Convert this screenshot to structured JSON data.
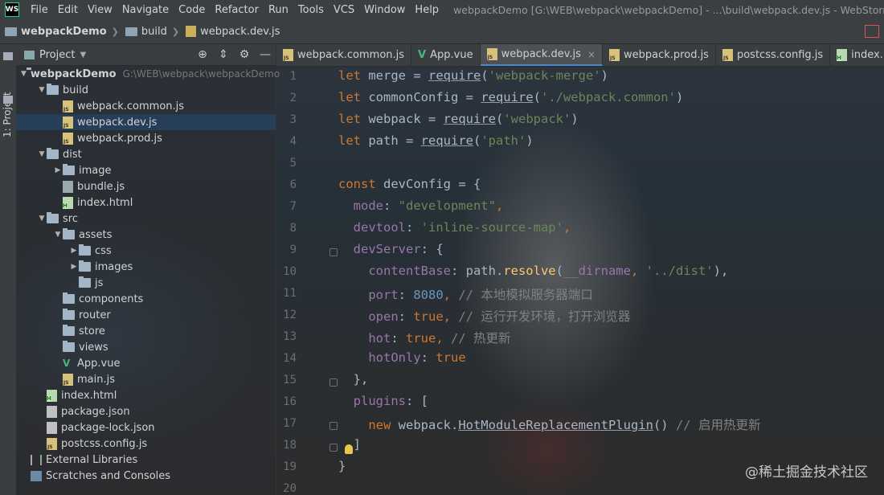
{
  "menubar": {
    "logo": "WS",
    "items": [
      "File",
      "Edit",
      "View",
      "Navigate",
      "Code",
      "Refactor",
      "Run",
      "Tools",
      "VCS",
      "Window",
      "Help"
    ],
    "window_title": "webpackDemo [G:\\WEB\\webpack\\webpackDemo] - ...\\build\\webpack.dev.js - WebStorm (Adminis"
  },
  "breadcrumb": [
    "webpackDemo",
    "build",
    "webpack.dev.js"
  ],
  "strip": {
    "project_tab": "1: Project"
  },
  "project_panel": {
    "title": "Project",
    "tree": [
      {
        "label": "webpackDemo",
        "hint": "G:\\WEB\\webpack\\webpackDemo",
        "icon": "folder",
        "arrow": "down",
        "level": 0
      },
      {
        "label": "build",
        "icon": "folder",
        "arrow": "down",
        "level": 1
      },
      {
        "label": "webpack.common.js",
        "icon": "js",
        "level": 2
      },
      {
        "label": "webpack.dev.js",
        "icon": "js",
        "level": 2,
        "selected": true
      },
      {
        "label": "webpack.prod.js",
        "icon": "js",
        "level": 2
      },
      {
        "label": "dist",
        "icon": "folder",
        "arrow": "down",
        "level": 1
      },
      {
        "label": "image",
        "icon": "folder",
        "arrow": "right",
        "level": 2
      },
      {
        "label": "bundle.js",
        "icon": "bin",
        "level": 2
      },
      {
        "label": "index.html",
        "icon": "html",
        "level": 2
      },
      {
        "label": "src",
        "icon": "folder",
        "arrow": "down",
        "level": 1
      },
      {
        "label": "assets",
        "icon": "folder",
        "arrow": "down",
        "level": 2
      },
      {
        "label": "css",
        "icon": "folder",
        "arrow": "right",
        "level": 3
      },
      {
        "label": "images",
        "icon": "folder",
        "arrow": "right",
        "level": 3
      },
      {
        "label": "js",
        "icon": "folder",
        "level": 3
      },
      {
        "label": "components",
        "icon": "folder",
        "level": 2
      },
      {
        "label": "router",
        "icon": "folder",
        "level": 2
      },
      {
        "label": "store",
        "icon": "folder",
        "level": 2
      },
      {
        "label": "views",
        "icon": "folder",
        "level": 2
      },
      {
        "label": "App.vue",
        "icon": "vue",
        "level": 2
      },
      {
        "label": "main.js",
        "icon": "js",
        "level": 2
      },
      {
        "label": "index.html",
        "icon": "html",
        "level": 1
      },
      {
        "label": "package.json",
        "icon": "json",
        "level": 1
      },
      {
        "label": "package-lock.json",
        "icon": "json",
        "level": 1
      },
      {
        "label": "postcss.config.js",
        "icon": "js",
        "level": 1
      },
      {
        "label": "External Libraries",
        "icon": "lib",
        "level": 0
      },
      {
        "label": "Scratches and Consoles",
        "icon": "cons",
        "level": 0
      }
    ]
  },
  "tabs": [
    {
      "label": "webpack.common.js",
      "icon": "js"
    },
    {
      "label": "App.vue",
      "icon": "vue"
    },
    {
      "label": "webpack.dev.js",
      "icon": "js",
      "active": true
    },
    {
      "label": "webpack.prod.js",
      "icon": "js"
    },
    {
      "label": "postcss.config.js",
      "icon": "js"
    },
    {
      "label": "index.",
      "icon": "html"
    }
  ],
  "editor": {
    "line_numbers": [
      "1",
      "2",
      "3",
      "4",
      "5",
      "6",
      "7",
      "8",
      "9",
      "10",
      "11",
      "12",
      "13",
      "14",
      "15",
      "16",
      "17",
      "18",
      "19",
      "20"
    ],
    "lines": [
      [
        [
          "kw",
          "let "
        ],
        [
          "",
          "merge = "
        ],
        [
          "ul",
          "require"
        ],
        [
          "",
          "("
        ],
        [
          "str",
          "'webpack-merge'"
        ],
        [
          "",
          ")"
        ]
      ],
      [
        [
          "kw",
          "let "
        ],
        [
          "",
          "commonConfig = "
        ],
        [
          "ul",
          "require"
        ],
        [
          "",
          "("
        ],
        [
          "str",
          "'./webpack.common'"
        ],
        [
          "",
          ")"
        ]
      ],
      [
        [
          "kw",
          "let "
        ],
        [
          "",
          "webpack = "
        ],
        [
          "ul",
          "require"
        ],
        [
          "",
          "("
        ],
        [
          "str",
          "'webpack'"
        ],
        [
          "",
          ")"
        ]
      ],
      [
        [
          "kw",
          "let "
        ],
        [
          "",
          "path = "
        ],
        [
          "ul",
          "require"
        ],
        [
          "",
          "("
        ],
        [
          "str",
          "'path'"
        ],
        [
          "",
          ")"
        ]
      ],
      [],
      [
        [
          "kw",
          "const "
        ],
        [
          "",
          "devConfig = {"
        ]
      ],
      [
        [
          "",
          "  "
        ],
        [
          "prop",
          "mode"
        ],
        [
          "",
          ": "
        ],
        [
          "str",
          "\"development\""
        ],
        [
          "kw",
          ","
        ]
      ],
      [
        [
          "",
          "  "
        ],
        [
          "prop",
          "devtool"
        ],
        [
          "",
          ": "
        ],
        [
          "str",
          "'inline-source-map'"
        ],
        [
          "kw",
          ","
        ]
      ],
      [
        [
          "",
          "  "
        ],
        [
          "prop",
          "devServer"
        ],
        [
          "",
          ": {"
        ]
      ],
      [
        [
          "",
          "    "
        ],
        [
          "prop",
          "contentBase"
        ],
        [
          "",
          ": path."
        ],
        [
          "fn",
          "resolve"
        ],
        [
          "",
          "("
        ],
        [
          "prop",
          "__dirname"
        ],
        [
          "kw",
          ", "
        ],
        [
          "str",
          "'../dist'"
        ],
        [
          "",
          "),"
        ]
      ],
      [
        [
          "",
          "    "
        ],
        [
          "prop",
          "port"
        ],
        [
          "",
          ": "
        ],
        [
          "num",
          "8080"
        ],
        [
          "kw",
          ", "
        ],
        [
          "cm",
          "// 本地模拟服务器端口"
        ]
      ],
      [
        [
          "",
          "    "
        ],
        [
          "prop",
          "open"
        ],
        [
          "",
          ": "
        ],
        [
          "kw",
          "true"
        ],
        [
          "kw",
          ", "
        ],
        [
          "cm",
          "// 运行开发环境，打开浏览器"
        ]
      ],
      [
        [
          "",
          "    "
        ],
        [
          "prop",
          "hot"
        ],
        [
          "",
          ": "
        ],
        [
          "kw",
          "true"
        ],
        [
          "kw",
          ", "
        ],
        [
          "cm",
          "// 热更新"
        ]
      ],
      [
        [
          "",
          "    "
        ],
        [
          "prop",
          "hotOnly"
        ],
        [
          "",
          ": "
        ],
        [
          "kw",
          "true"
        ]
      ],
      [
        [
          "",
          "  },"
        ]
      ],
      [
        [
          "",
          "  "
        ],
        [
          "prop",
          "plugins"
        ],
        [
          "",
          ": ["
        ]
      ],
      [
        [
          "",
          "    "
        ],
        [
          "kw",
          "new "
        ],
        [
          "",
          "webpack."
        ],
        [
          "ul",
          "HotModuleReplacementPlugin"
        ],
        [
          "",
          "() "
        ],
        [
          "cm",
          "// 启用热更新"
        ]
      ],
      [
        [
          "",
          "  ]"
        ]
      ],
      [
        [
          "",
          "}"
        ]
      ],
      []
    ]
  },
  "watermark": "@稀土掘金技术社区"
}
